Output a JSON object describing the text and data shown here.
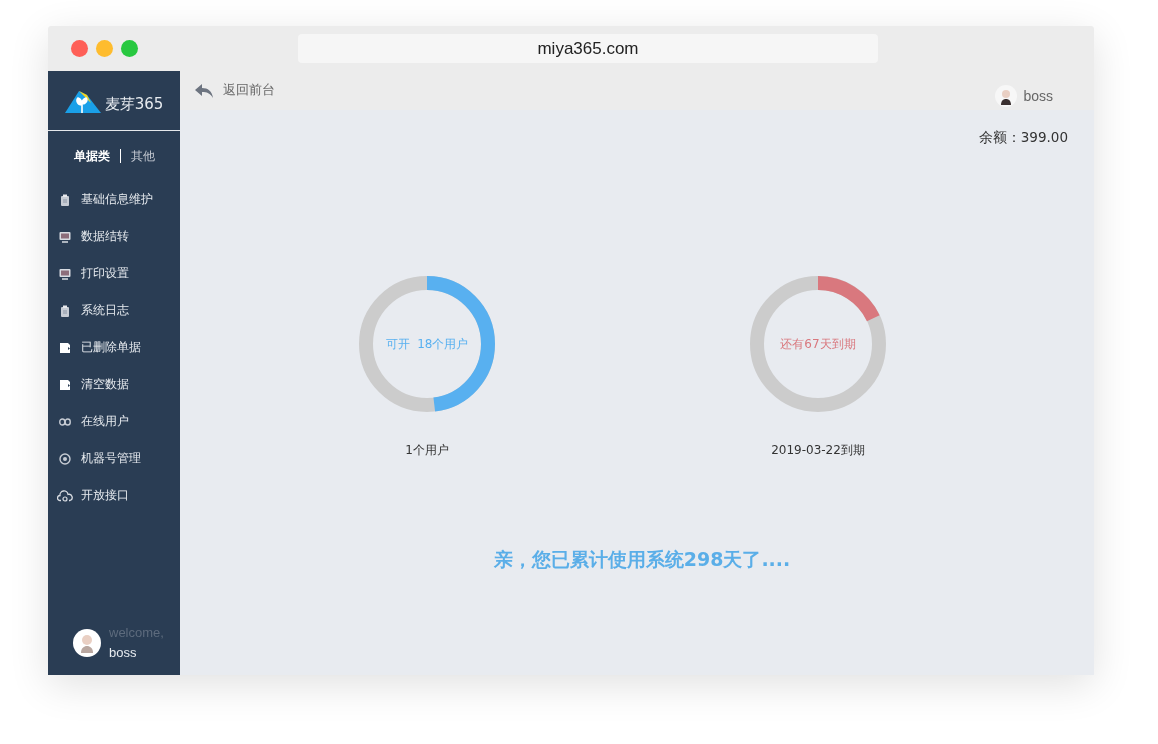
{
  "browser": {
    "url": "miya365.com"
  },
  "sidebar": {
    "logo_text": "麦芽365",
    "tabs": [
      {
        "label": "单据类",
        "selected": true
      },
      {
        "label": "其他",
        "selected": false
      }
    ],
    "items": [
      {
        "label": "基础信息维护",
        "kind": "clipboard"
      },
      {
        "label": "数据结转",
        "kind": "monitor"
      },
      {
        "label": "打印设置",
        "kind": "monitor"
      },
      {
        "label": "系统日志",
        "kind": "clipboard"
      },
      {
        "label": "已删除单据",
        "kind": "document"
      },
      {
        "label": "清空数据",
        "kind": "document"
      },
      {
        "label": "在线用户",
        "kind": "link"
      },
      {
        "label": "机器号管理",
        "kind": "target"
      },
      {
        "label": "开放接口",
        "kind": "cloud"
      }
    ],
    "welcome": "welcome,",
    "user": "boss"
  },
  "topbar": {
    "back": "返回前台",
    "user": "boss"
  },
  "balance": "余额：399.00",
  "meters": [
    {
      "center_text": "可开  18个用户",
      "caption": "1个用户",
      "level": 0.48,
      "color": "#58b0f0"
    },
    {
      "center_text": "还有67天到期",
      "caption": "2019-03-22到期",
      "level": 0.18,
      "color": "#d9787e"
    }
  ],
  "message": "亲，您已累计使用系统298天了...."
}
